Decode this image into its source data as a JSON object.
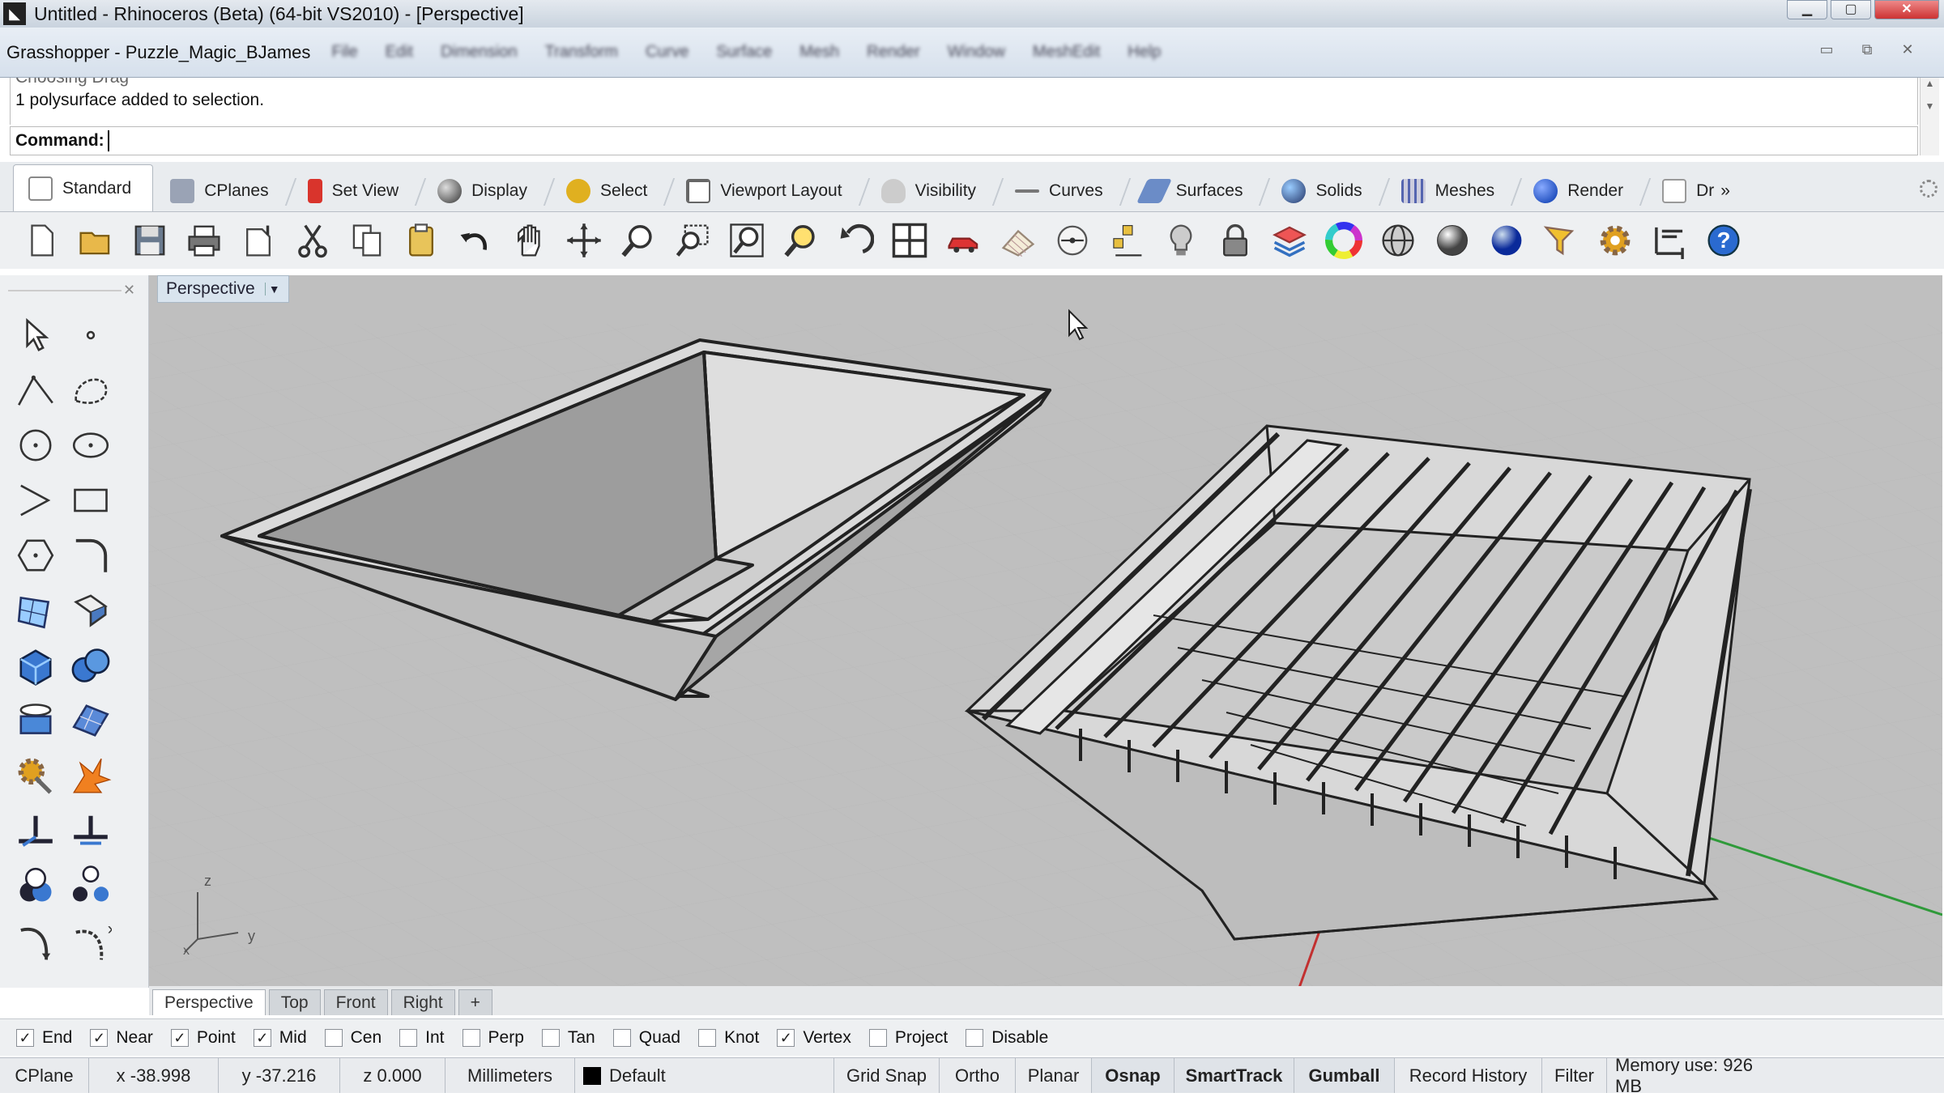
{
  "window": {
    "title": "Untitled - Rhinoceros (Beta) (64-bit VS2010) - [Perspective]"
  },
  "grasshopper": {
    "title": "Grasshopper - Puzzle_Magic_BJames",
    "menu": [
      "File",
      "Edit",
      "Dimension",
      "Transform",
      "Curve",
      "Surface",
      "Mesh",
      "Render",
      "Window",
      "MeshEdit",
      "Help"
    ]
  },
  "command": {
    "history_line1": "Choosing Drag",
    "history_line2": "1 polysurface added to selection.",
    "prompt": "Command:"
  },
  "tabs": [
    {
      "label": "Standard",
      "color": "#ffffff"
    },
    {
      "label": "CPlanes",
      "color": "#9aa3b5"
    },
    {
      "label": "Set View",
      "color": "#d9342c"
    },
    {
      "label": "Display",
      "color": "#555555"
    },
    {
      "label": "Select",
      "color": "#e0b020"
    },
    {
      "label": "Viewport Layout",
      "color": "#888888"
    },
    {
      "label": "Visibility",
      "color": "#b0b0b0"
    },
    {
      "label": "Curves",
      "color": "#777777"
    },
    {
      "label": "Surfaces",
      "color": "#6b8cc7"
    },
    {
      "label": "Solids",
      "color": "#4a6fd0"
    },
    {
      "label": "Meshes",
      "color": "#5565b0"
    },
    {
      "label": "Render",
      "color": "#1c4cb8"
    },
    {
      "label": "Dr",
      "color": "#dddddd"
    }
  ],
  "tabs_overflow": "»",
  "toolbar_icons": [
    "new-icon",
    "open-icon",
    "save-icon",
    "print-icon",
    "import-icon",
    "cut-icon",
    "copy-icon",
    "paste-icon",
    "undo-icon",
    "pan-icon",
    "rotate-view-icon",
    "zoom-icon",
    "zoom-window-icon",
    "zoom-extents-icon",
    "zoom-selected-icon",
    "undo-view-icon",
    "four-viewports-icon",
    "car-icon",
    "grid-icon",
    "properties-icon",
    "snap-icon",
    "light-icon",
    "lock-icon",
    "layer-icon",
    "color-wheel-icon",
    "wireframe-sphere-icon",
    "shaded-sphere-icon",
    "rendered-sphere-icon",
    "filter-icon",
    "options-gear-icon",
    "dimension-icon",
    "help-icon"
  ],
  "viewport": {
    "name": "Perspective",
    "axis_z": "z",
    "axis_y": "y",
    "axis_x": "x"
  },
  "viewport_tabs": [
    "Perspective",
    "Top",
    "Front",
    "Right"
  ],
  "viewport_tab_add": "+",
  "osnaps": [
    {
      "label": "End",
      "checked": true
    },
    {
      "label": "Near",
      "checked": true
    },
    {
      "label": "Point",
      "checked": true
    },
    {
      "label": "Mid",
      "checked": true
    },
    {
      "label": "Cen",
      "checked": false
    },
    {
      "label": "Int",
      "checked": false
    },
    {
      "label": "Perp",
      "checked": false
    },
    {
      "label": "Tan",
      "checked": false
    },
    {
      "label": "Quad",
      "checked": false
    },
    {
      "label": "Knot",
      "checked": false
    },
    {
      "label": "Vertex",
      "checked": true
    },
    {
      "label": "Project",
      "checked": false
    },
    {
      "label": "Disable",
      "checked": false
    }
  ],
  "status": {
    "cplane": "CPlane",
    "x": "x -38.998",
    "y": "y -37.216",
    "z": "z 0.000",
    "units": "Millimeters",
    "layer": "Default",
    "grid_snap": "Grid Snap",
    "ortho": "Ortho",
    "planar": "Planar",
    "osnap": "Osnap",
    "smarttrack": "SmartTrack",
    "gumball": "Gumball",
    "record_history": "Record History",
    "filter": "Filter",
    "memory": "Memory use: 926 MB"
  },
  "colors": {
    "viewport_bg": "#bfbfbf",
    "grid_line": "#b0b0b0",
    "x_axis": "#c23030",
    "y_axis": "#2f9a3a"
  }
}
